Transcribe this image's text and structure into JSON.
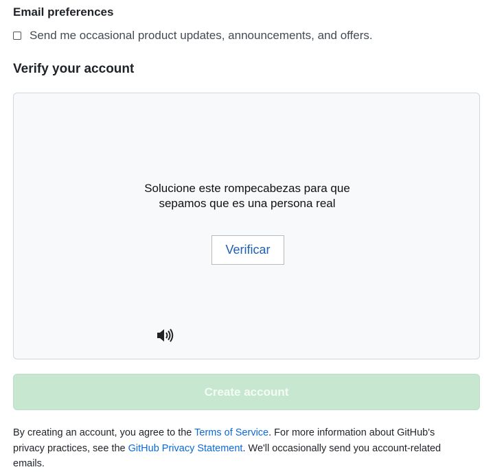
{
  "email_preferences": {
    "heading": "Email preferences",
    "checkbox_label": "Send me occasional product updates, announcements, and offers.",
    "checked": false
  },
  "verify": {
    "heading": "Verify your account",
    "captcha_line1": "Solucione este rompecabezas para que",
    "captcha_line2": "sepamos que es una persona real",
    "verify_button": "Verificar",
    "audio_icon": "speaker-icon"
  },
  "create_account": {
    "label": "Create account",
    "color": "#c7e7d1"
  },
  "legal": {
    "text1": "By creating an account, you agree to the ",
    "terms_link": "Terms of Service",
    "text2": ". For more information about GitHub's privacy practices, see the ",
    "privacy_link": "GitHub Privacy Statement",
    "text3": ". We'll occasionally send you account-related emails."
  },
  "colors": {
    "link": "#0969da",
    "verify_text": "#1e5fb4"
  }
}
